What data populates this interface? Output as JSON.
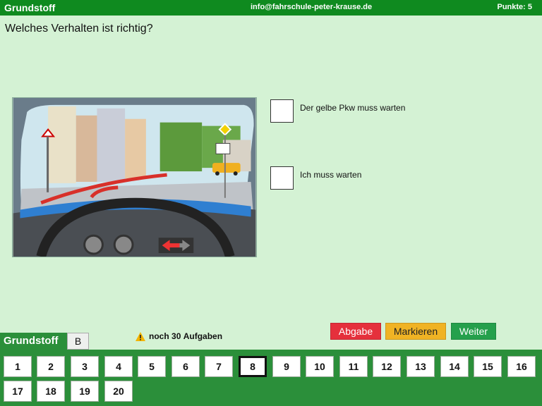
{
  "header": {
    "title": "Grundstoff",
    "email": "info@fahrschule-peter-krause.de",
    "score": "Punkte: 5"
  },
  "question": "Welches Verhalten ist richtig?",
  "answers": [
    {
      "text": "Der gelbe Pkw muss warten"
    },
    {
      "text": "Ich muss warten"
    }
  ],
  "footer": {
    "tab_main": "Grundstoff",
    "tab_b": "B",
    "remaining_prefix": "noch",
    "remaining_count": "30",
    "remaining_suffix": "Aufgaben",
    "abgabe": "Abgabe",
    "markieren": "Markieren",
    "weiter": "Weiter"
  },
  "numbers": [
    "1",
    "2",
    "3",
    "4",
    "5",
    "6",
    "7",
    "8",
    "9",
    "10",
    "11",
    "12",
    "13",
    "14",
    "15",
    "16",
    "17",
    "18",
    "19",
    "20"
  ],
  "active_number": "8",
  "colors": {
    "header_green": "#0f8a1f",
    "panel_green": "#2b8f3a",
    "background": "#d4f2d4"
  }
}
